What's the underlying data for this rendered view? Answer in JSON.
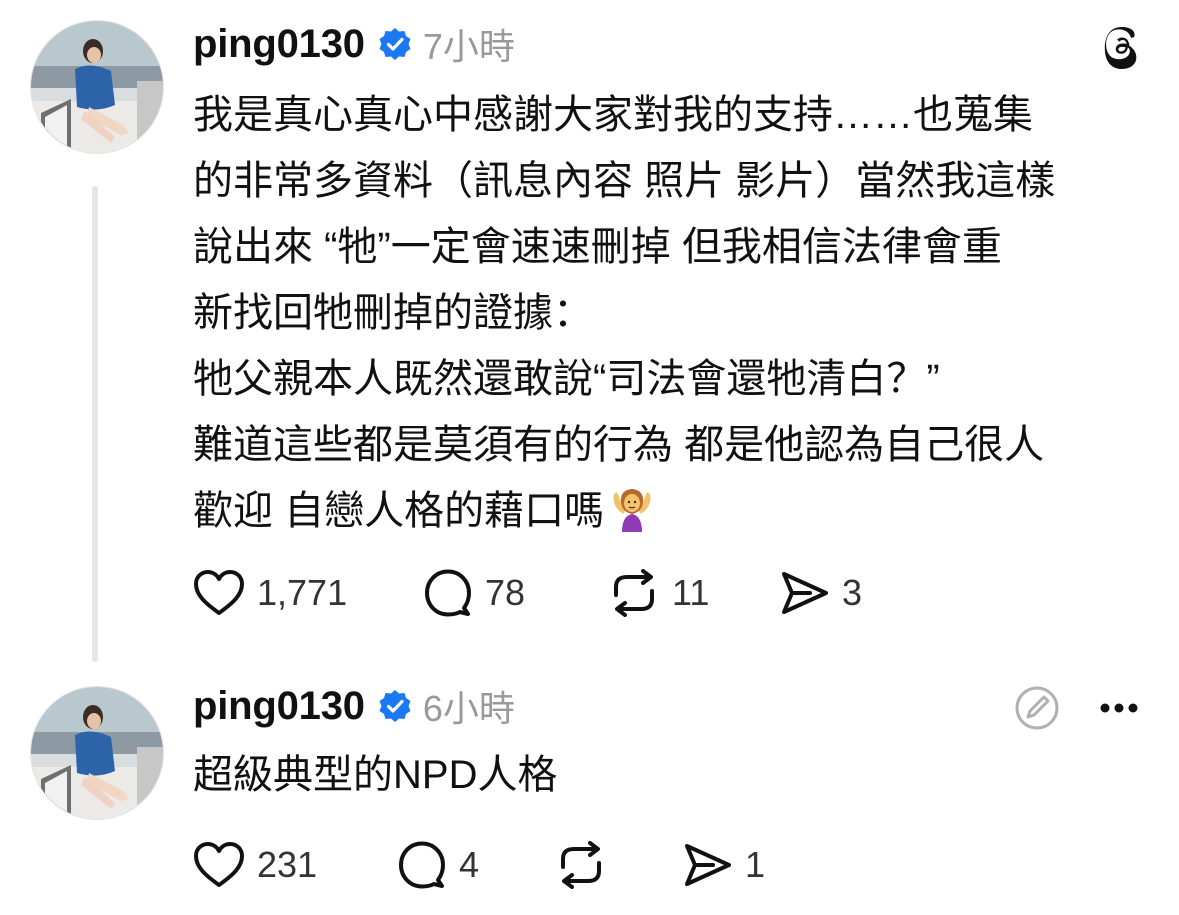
{
  "colors": {
    "text": "#111111",
    "muted": "#999999",
    "verified": "#1a78f2",
    "thread_line": "#e6e6e6"
  },
  "posts": [
    {
      "username": "ping0130",
      "time": "7小時",
      "verified_icon": "verified-badge-icon",
      "body": [
        "我是真心真心中感謝大家對我的支持……也蒐集",
        "的非常多資料（訊息內容 照片 影片）當然我這樣",
        "說出來 “牠”一定會速速刪掉 但我相信法律會重",
        "新找回牠刪掉的證據：",
        "牠父親本人既然還敢說“司法會還牠清白？”",
        "難道這些都是莫須有的行為 都是他認為自己很人",
        "歡迎 自戀人格的藉口嗎"
      ],
      "emoji": "person-shrugging-emoji",
      "likes": "1,771",
      "replies": "78",
      "reposts": "11",
      "shares": "3"
    },
    {
      "username": "ping0130",
      "time": "6小時",
      "verified_icon": "verified-badge-icon",
      "body": [
        "超級典型的NPD人格"
      ],
      "likes": "231",
      "replies": "4",
      "reposts": "",
      "shares": "1"
    }
  ]
}
